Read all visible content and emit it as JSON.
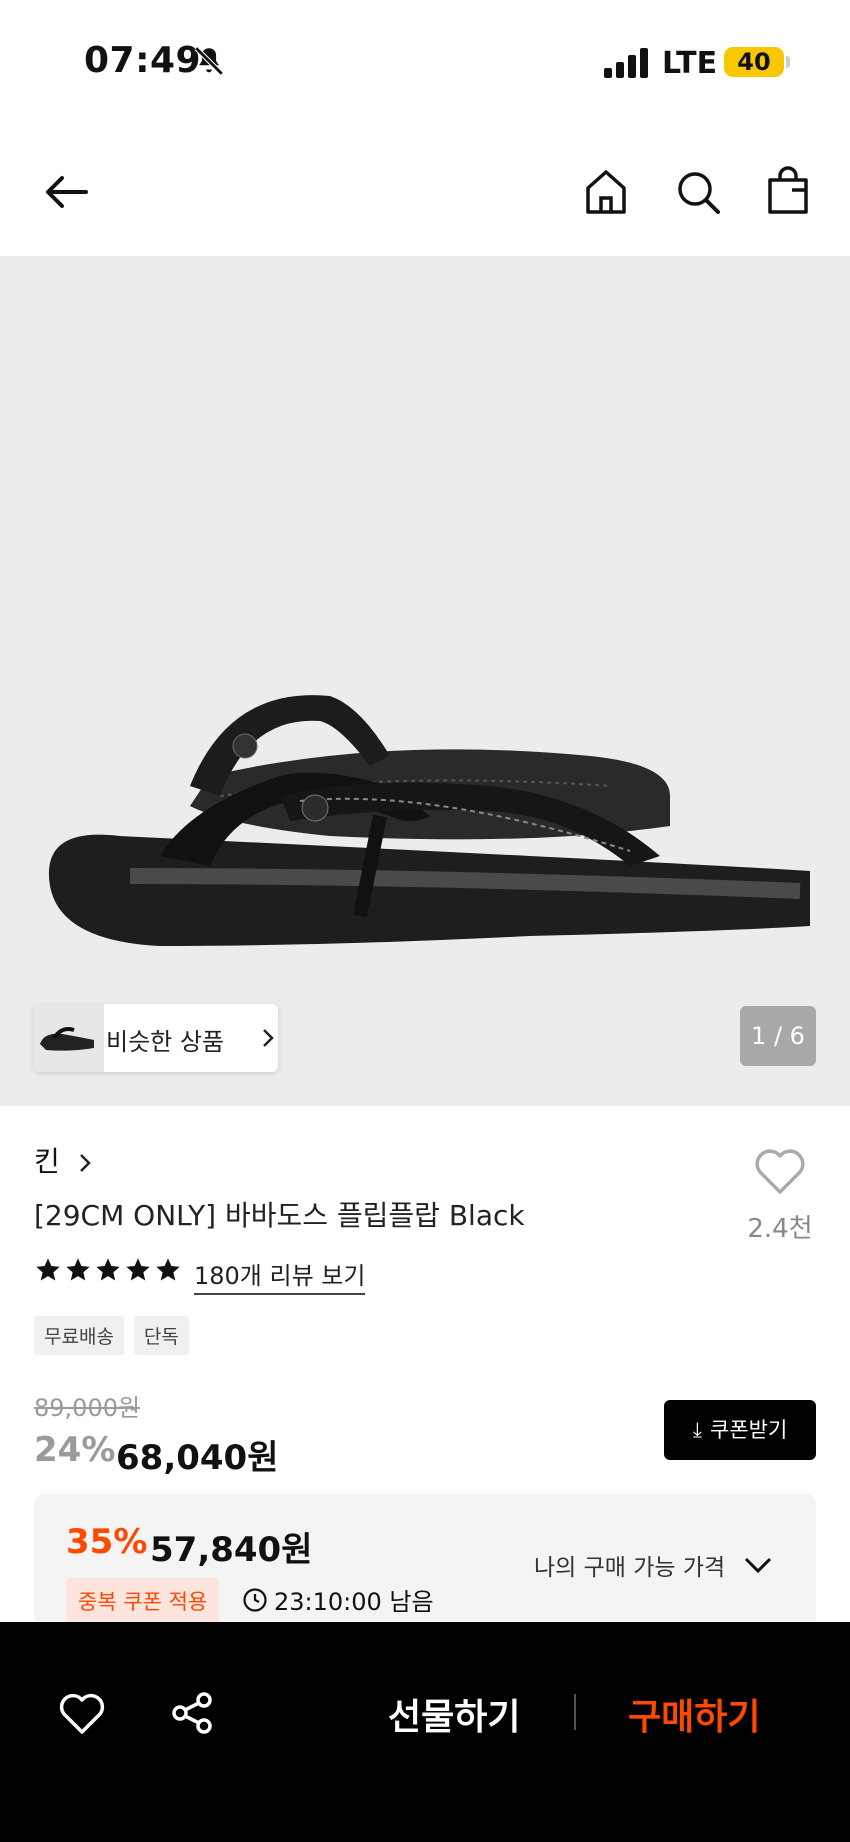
{
  "status_bar": {
    "time": "07:49",
    "network": "LTE",
    "battery": "40"
  },
  "nav": {
    "back": "back-icon",
    "home": "home-icon",
    "search": "search-icon",
    "bag": "shopping-bag-icon"
  },
  "gallery": {
    "similar_label": "비슷한 상품",
    "pager": "1 / 6"
  },
  "product": {
    "brand": "킨",
    "title": "[29CM ONLY] 바바도스 플립플랍 Black",
    "like_count": "2.4천",
    "rating_stars": 5,
    "review_link": "180개 리뷰 보기",
    "tags": [
      "무료배송",
      "단독"
    ]
  },
  "price": {
    "original": "89,000원",
    "discount": "24%",
    "current": "68,040원",
    "coupon_button": "쿠폰받기"
  },
  "offer": {
    "rate": "35%",
    "price": "57,840원",
    "tag": "중복 쿠폰 적용",
    "timer": "23:10:00 남음",
    "my_price_label": "나의 구매 가능 가격"
  },
  "bottom": {
    "gift": "선물하기",
    "buy": "구매하기"
  },
  "colors": {
    "accent": "#ff4800",
    "battery": "#f7c800",
    "hero_bg": "#ececec"
  }
}
